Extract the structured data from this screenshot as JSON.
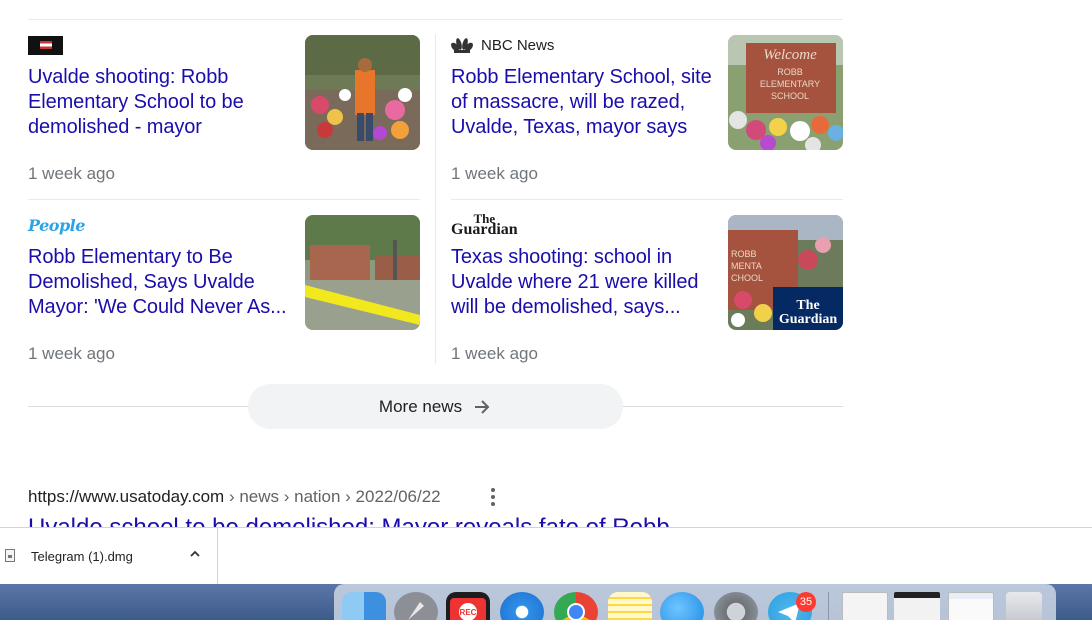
{
  "news_cards": [
    {
      "source_logo": "flag-logo",
      "source_name": "",
      "headline": "Uvalde shooting: Robb Elementary School to be demolished - mayor",
      "time": "1 week ago",
      "thumb": "memorial-flowers-photo"
    },
    {
      "source_logo": "nbc-peacock-icon",
      "source_name": "NBC News",
      "headline": "Robb Elementary School, site of massacre, will be razed, Uvalde, Texas, mayor says",
      "time": "1 week ago",
      "thumb": "school-sign-memorial-photo"
    },
    {
      "source_logo": "people-logo",
      "source_name": "People",
      "headline": "Robb Elementary to Be Demolished, Says Uvalde Mayor: 'We Could Never As...",
      "time": "1 week ago",
      "thumb": "school-police-tape-photo"
    },
    {
      "source_logo": "guardian-logo",
      "source_name": "The Guardian",
      "headline": "Texas shooting: school in Uvalde where 21 were killed will be demolished, says...",
      "time": "1 week ago",
      "thumb": "guardian-memorial-photo",
      "thumb_overlay": "The Guardian"
    }
  ],
  "more_news": {
    "label": "More news",
    "icon": "arrow-right-icon"
  },
  "result": {
    "url": "https://www.usatoday.com",
    "breadcrumb": " › news › nation › 2022/06/22",
    "title": "Uvalde school to be demolished: Mayor reveals fate of Robb",
    "menu_icon": "more-vert-icon"
  },
  "download_bar": {
    "file_name": "Telegram (1).dmg",
    "caret_icon": "chevron-up-icon"
  },
  "dock": {
    "apps": [
      "finder-icon",
      "launchpad-icon",
      "screen-recorder-icon",
      "safari-icon",
      "chrome-icon",
      "notes-icon",
      "messenger-icon",
      "system-preferences-icon",
      "telegram-icon"
    ],
    "telegram_badge": "35",
    "recorder_label": "REC"
  }
}
